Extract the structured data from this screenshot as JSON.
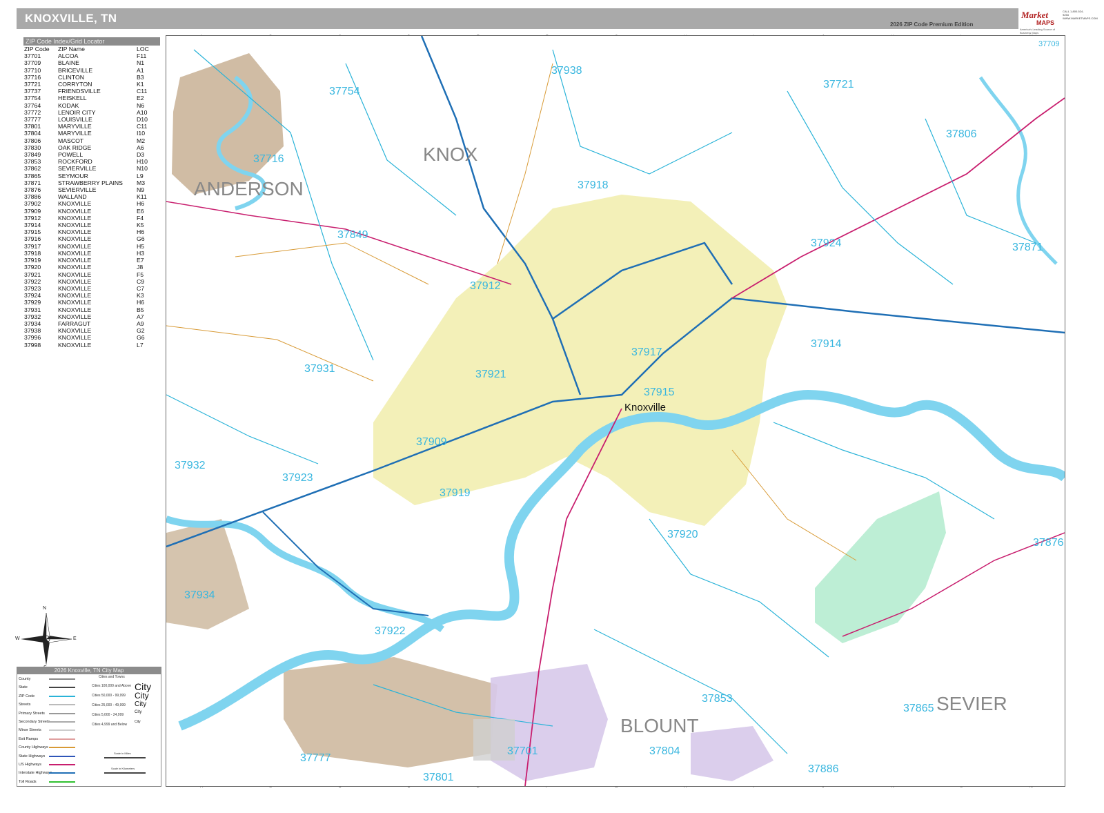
{
  "header": {
    "title": "KNOXVILLE, TN",
    "edition": "2026 ZIP Code Premium Edition",
    "logo_line1": "Market",
    "logo_line2": "MAPS",
    "logo_tagline": "America's Leading Source of Business Maps",
    "logo_contact": "CALL 1-800-524-9253 WWW.MARKETMAPS.COM"
  },
  "index": {
    "header": "ZIP Code Index/Grid Locator",
    "columns": [
      "ZIP Code",
      "ZIP Name",
      "LOC"
    ],
    "rows": [
      [
        "37701",
        "ALCOA",
        "F11"
      ],
      [
        "37709",
        "BLAINE",
        "N1"
      ],
      [
        "37710",
        "BRICEVILLE",
        "A1"
      ],
      [
        "37716",
        "CLINTON",
        "B3"
      ],
      [
        "37721",
        "CORRYTON",
        "K1"
      ],
      [
        "37737",
        "FRIENDSVILLE",
        "C11"
      ],
      [
        "37754",
        "HEISKELL",
        "E2"
      ],
      [
        "37764",
        "KODAK",
        "N6"
      ],
      [
        "37772",
        "LENOIR CITY",
        "A10"
      ],
      [
        "37777",
        "LOUISVILLE",
        "D10"
      ],
      [
        "37801",
        "MARYVILLE",
        "C11"
      ],
      [
        "37804",
        "MARYVILLE",
        "I10"
      ],
      [
        "37806",
        "MASCOT",
        "M2"
      ],
      [
        "37830",
        "OAK RIDGE",
        "A6"
      ],
      [
        "37849",
        "POWELL",
        "D3"
      ],
      [
        "37853",
        "ROCKFORD",
        "H10"
      ],
      [
        "37862",
        "SEVIERVILLE",
        "N10"
      ],
      [
        "37865",
        "SEYMOUR",
        "L9"
      ],
      [
        "37871",
        "STRAWBERRY PLAINS",
        "M3"
      ],
      [
        "37876",
        "SEVIERVILLE",
        "N9"
      ],
      [
        "37886",
        "WALLAND",
        "K11"
      ],
      [
        "37902",
        "KNOXVILLE",
        "H6"
      ],
      [
        "37909",
        "KNOXVILLE",
        "E6"
      ],
      [
        "37912",
        "KNOXVILLE",
        "F4"
      ],
      [
        "37914",
        "KNOXVILLE",
        "K5"
      ],
      [
        "37915",
        "KNOXVILLE",
        "H6"
      ],
      [
        "37916",
        "KNOXVILLE",
        "G6"
      ],
      [
        "37917",
        "KNOXVILLE",
        "H5"
      ],
      [
        "37918",
        "KNOXVILLE",
        "H3"
      ],
      [
        "37919",
        "KNOXVILLE",
        "E7"
      ],
      [
        "37920",
        "KNOXVILLE",
        "J8"
      ],
      [
        "37921",
        "KNOXVILLE",
        "F5"
      ],
      [
        "37922",
        "KNOXVILLE",
        "C9"
      ],
      [
        "37923",
        "KNOXVILLE",
        "C7"
      ],
      [
        "37924",
        "KNOXVILLE",
        "K3"
      ],
      [
        "37929",
        "KNOXVILLE",
        "H6"
      ],
      [
        "37931",
        "KNOXVILLE",
        "B5"
      ],
      [
        "37932",
        "KNOXVILLE",
        "A7"
      ],
      [
        "37934",
        "FARRAGUT",
        "A9"
      ],
      [
        "37938",
        "KNOXVILLE",
        "G2"
      ],
      [
        "37996",
        "KNOXVILLE",
        "G6"
      ],
      [
        "37998",
        "KNOXVILLE",
        "L7"
      ]
    ]
  },
  "grid": {
    "columns": [
      "A",
      "B",
      "C",
      "D",
      "E",
      "F",
      "G",
      "H",
      "I",
      "J",
      "K",
      "L",
      "M"
    ]
  },
  "map": {
    "counties": [
      "ANDERSON",
      "KNOX",
      "BLOUNT",
      "SEVIER"
    ],
    "major_city": "Knoxville",
    "zip_labels": [
      "37709",
      "37938",
      "37721",
      "37754",
      "37806",
      "37716",
      "37918",
      "37849",
      "37924",
      "37871",
      "37912",
      "37914",
      "37917",
      "37931",
      "37921",
      "37915",
      "37909",
      "37932",
      "37923",
      "37919",
      "37920",
      "37876",
      "37934",
      "37922",
      "37853",
      "37865",
      "37804",
      "37701",
      "37777",
      "37886",
      "37801"
    ],
    "colors": {
      "water": "#7fd4ef",
      "urban": "#f3f0b8",
      "anderson_area": "#cbb59a",
      "sevier_area": "#b6ecd0",
      "blount_area": "#d7c9ea",
      "zip_boundary": "#2ab3d8",
      "interstate": "#1f6fb5",
      "us_highway": "#c81e6e",
      "state_highway": "#2f55b8",
      "county_highway": "#d89a35"
    }
  },
  "compass": {
    "n": "N",
    "s": "S",
    "e": "E",
    "w": "W"
  },
  "legend": {
    "title": "2026 Knoxville, TN City Map",
    "cities_header": "Cities and Towns",
    "items": [
      "County",
      "State",
      "ZIP Code",
      "Streets",
      "Primary Streets",
      "Secondary Streets",
      "Minor Streets",
      "Exit Ramps",
      "County Highways",
      "State Highways",
      "US Highways",
      "Interstate Highways",
      "Toll Roads"
    ],
    "city_sizes": [
      "Cities 100,000 and Above",
      "Cities 50,000 - 99,999",
      "Cities 25,000 - 49,999",
      "Cities 5,000 - 24,999",
      "Cities 4,999 and Below"
    ],
    "city_sample": [
      "City",
      "City",
      "City",
      "City",
      "City"
    ],
    "scale_miles": "Scale in Miles",
    "scale_km": "Scale in Kilometers"
  }
}
